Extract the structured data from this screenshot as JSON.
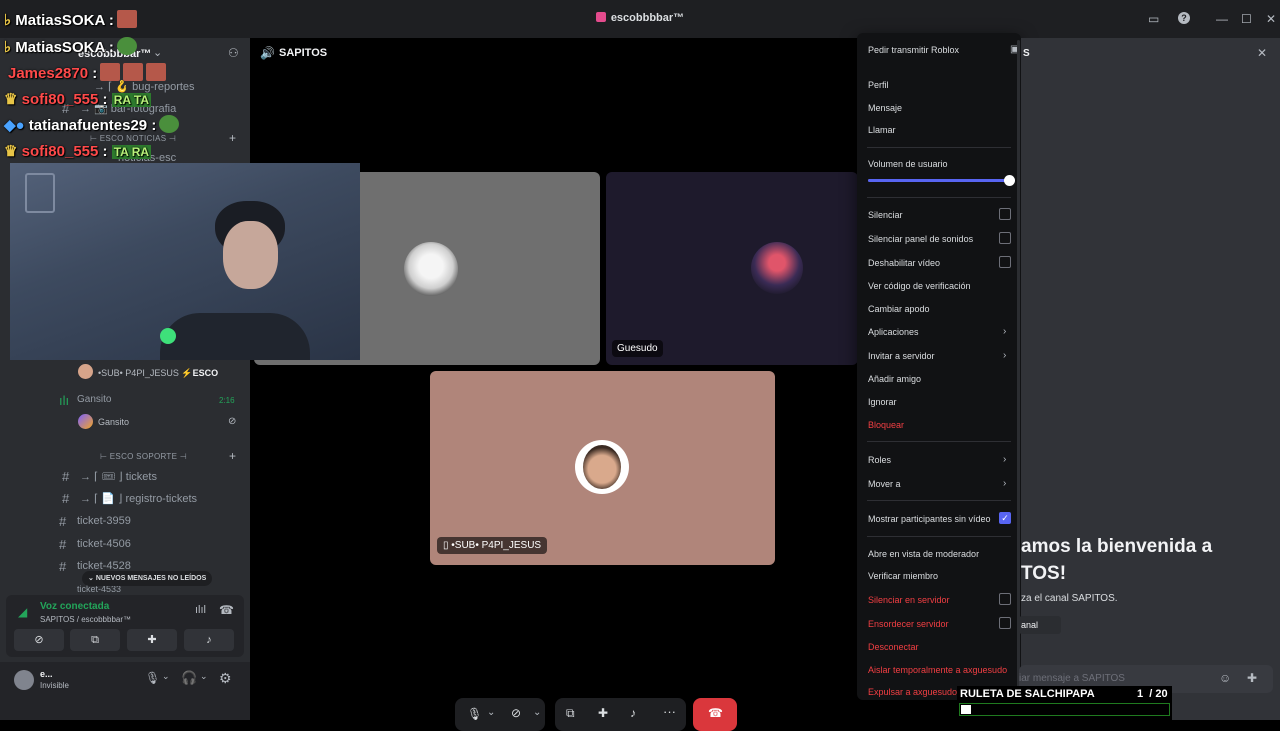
{
  "titlebar": {
    "title": "escobbbbar™"
  },
  "overlay_chat": [
    {
      "user": "MatiasSOKA",
      "color": "#ffffff",
      "sep": ":"
    },
    {
      "user": "MatiasSOKA",
      "color": "#ffffff",
      "sep": ":"
    },
    {
      "user": "James2870",
      "color": "#ff4a4a",
      "sep": ":"
    },
    {
      "user": "sofi80_555",
      "color": "#ff4a4a",
      "sep": ":",
      "msg": "RA TA"
    },
    {
      "user": "tatianafuentes29",
      "color": "#ffffff",
      "sep": ":"
    },
    {
      "user": "sofi80_555",
      "color": "#ff4a4a",
      "sep": ":",
      "msg": "TA RA"
    }
  ],
  "sidebar": {
    "server_name": "escobbbbar™",
    "channels_top": [
      {
        "label": "→ ⌈ 🪝 bug-reportes"
      },
      {
        "label": "→ 📷 bar-fotografia"
      }
    ],
    "cat_news": "⊢ ESCO NOTICIAS ⊣",
    "chan_news": "noticias-esc",
    "voice_user_sub": "•SUB• P4PI_JESUS",
    "voice_user_sub_badge": "ESCO",
    "voice_channel": "Gansito",
    "voice_channel_time": "2:16",
    "voice_channel_member": "Gansito",
    "cat_support": "⊢ ESCO SOPORTE ⊣",
    "support_channels": [
      "→ ⌈ 🎟 ⌋ tickets",
      "→ ⌈ 📄 ⌋ registro-tickets",
      "ticket-3959",
      "ticket-4506",
      "ticket-4528",
      "ticket-4533"
    ],
    "new_messages": "NUEVOS MENSAJES NO LEÍDOS",
    "voice_status": "Voz conectada",
    "voice_location": "SAPITOS / escobbbbar™",
    "user_name": "e...",
    "user_status": "Invisible"
  },
  "stage": {
    "channel_name": "SAPITOS",
    "tile_guesudo": "Guesudo",
    "tile_jesus": "•SUB• P4PI_JESUS"
  },
  "context_menu": {
    "stream_request": "Pedir transmitir Roblox",
    "items": [
      {
        "label": "Perfil"
      },
      {
        "label": "Mensaje"
      },
      {
        "label": "Llamar"
      }
    ],
    "volume_label": "Volumen de usuario",
    "volume_level": 1.0,
    "toggles": [
      {
        "label": "Silenciar",
        "checked": false
      },
      {
        "label": "Silenciar panel de sonidos",
        "checked": false
      },
      {
        "label": "Deshabilitar vídeo",
        "checked": false
      }
    ],
    "more": [
      {
        "label": "Ver código de verificación"
      },
      {
        "label": "Cambiar apodo"
      },
      {
        "label": "Aplicaciones",
        "sub": true
      },
      {
        "label": "Invitar a servidor",
        "sub": true
      },
      {
        "label": "Añadir amigo"
      },
      {
        "label": "Ignorar"
      },
      {
        "label": "Bloquear",
        "red": true
      }
    ],
    "roles": "Roles",
    "move_to": "Mover a",
    "show_participants": "Mostrar participantes sin vídeo",
    "mod_view": "Abre en vista de moderador",
    "verify_member": "Verificar miembro",
    "server_mute": "Silenciar en servidor",
    "server_deafen": "Ensordecer servidor",
    "disconnect": "Desconectar",
    "timeout": "Aislar temporalmente a axguesudo",
    "kick": "Expulsar a axguesudo"
  },
  "right_panel": {
    "header_suffix": "S",
    "welcome_line1": "amos la bienvenida a",
    "welcome_line2": "TOS!",
    "welcome_desc": "za el canal SAPITOS.",
    "chip": "anal",
    "input_placeholder": "iar mensaje a SAPITOS",
    "roulette_title": "RULETA DE SALCHIPAPA",
    "roulette_count": "1  / 20",
    "roulette_progress": 0.05
  }
}
